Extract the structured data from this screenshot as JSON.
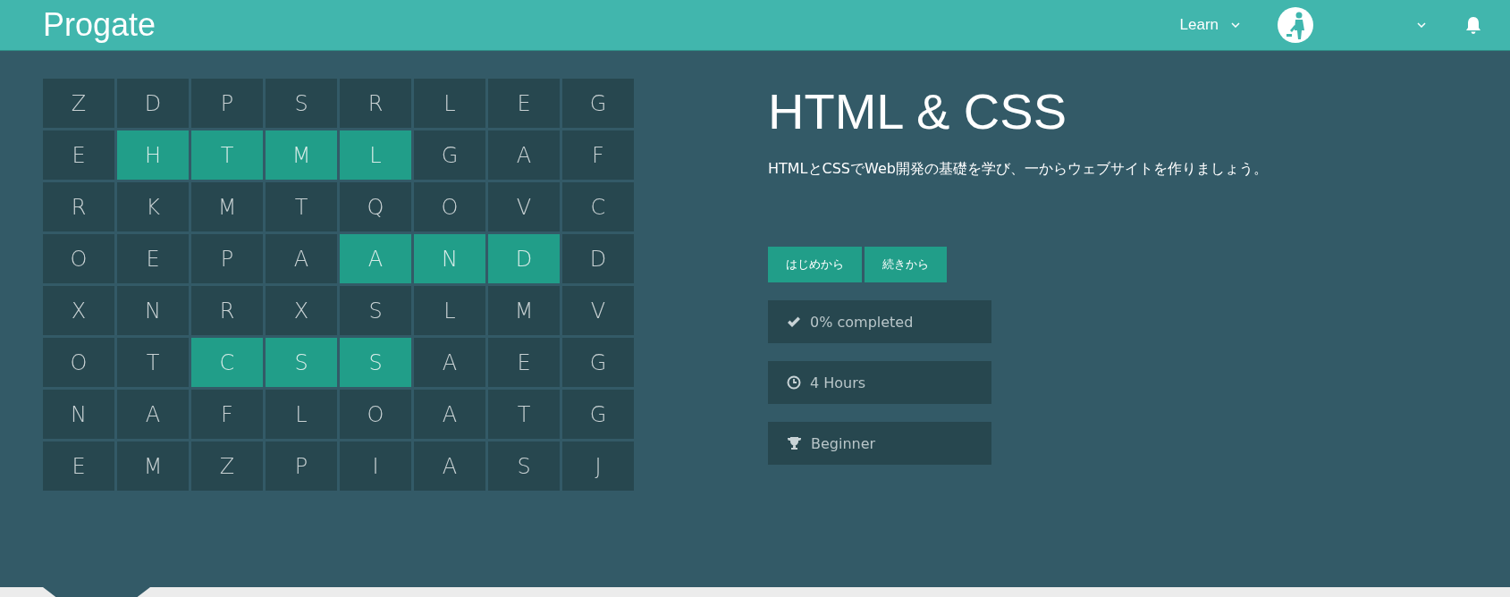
{
  "header": {
    "logo": "Progate",
    "nav": [
      {
        "label": "Learn",
        "kind": "menu"
      }
    ]
  },
  "grid": {
    "rows": [
      [
        {
          "letter": "Z",
          "highlighted": false
        },
        {
          "letter": "D",
          "highlighted": false
        },
        {
          "letter": "P",
          "highlighted": false
        },
        {
          "letter": "S",
          "highlighted": false
        },
        {
          "letter": "R",
          "highlighted": false
        },
        {
          "letter": "L",
          "highlighted": false
        },
        {
          "letter": "E",
          "highlighted": false
        },
        {
          "letter": "G",
          "highlighted": false
        }
      ],
      [
        {
          "letter": "E",
          "highlighted": false
        },
        {
          "letter": "H",
          "highlighted": true
        },
        {
          "letter": "T",
          "highlighted": true
        },
        {
          "letter": "M",
          "highlighted": true
        },
        {
          "letter": "L",
          "highlighted": true
        },
        {
          "letter": "G",
          "highlighted": false
        },
        {
          "letter": "A",
          "highlighted": false
        },
        {
          "letter": "F",
          "highlighted": false
        }
      ],
      [
        {
          "letter": "R",
          "highlighted": false
        },
        {
          "letter": "K",
          "highlighted": false
        },
        {
          "letter": "M",
          "highlighted": false
        },
        {
          "letter": "T",
          "highlighted": false
        },
        {
          "letter": "Q",
          "highlighted": false
        },
        {
          "letter": "O",
          "highlighted": false
        },
        {
          "letter": "V",
          "highlighted": false
        },
        {
          "letter": "C",
          "highlighted": false
        }
      ],
      [
        {
          "letter": "O",
          "highlighted": false
        },
        {
          "letter": "E",
          "highlighted": false
        },
        {
          "letter": "P",
          "highlighted": false
        },
        {
          "letter": "A",
          "highlighted": false
        },
        {
          "letter": "A",
          "highlighted": true
        },
        {
          "letter": "N",
          "highlighted": true
        },
        {
          "letter": "D",
          "highlighted": true
        },
        {
          "letter": "D",
          "highlighted": false
        }
      ],
      [
        {
          "letter": "X",
          "highlighted": false
        },
        {
          "letter": "N",
          "highlighted": false
        },
        {
          "letter": "R",
          "highlighted": false
        },
        {
          "letter": "X",
          "highlighted": false
        },
        {
          "letter": "S",
          "highlighted": false
        },
        {
          "letter": "L",
          "highlighted": false
        },
        {
          "letter": "M",
          "highlighted": false
        },
        {
          "letter": "V",
          "highlighted": false
        }
      ],
      [
        {
          "letter": "O",
          "highlighted": false
        },
        {
          "letter": "T",
          "highlighted": false
        },
        {
          "letter": "C",
          "highlighted": true
        },
        {
          "letter": "S",
          "highlighted": true
        },
        {
          "letter": "S",
          "highlighted": true
        },
        {
          "letter": "A",
          "highlighted": false
        },
        {
          "letter": "E",
          "highlighted": false
        },
        {
          "letter": "G",
          "highlighted": false
        }
      ],
      [
        {
          "letter": "N",
          "highlighted": false
        },
        {
          "letter": "A",
          "highlighted": false
        },
        {
          "letter": "F",
          "highlighted": false
        },
        {
          "letter": "L",
          "highlighted": false
        },
        {
          "letter": "O",
          "highlighted": false
        },
        {
          "letter": "A",
          "highlighted": false
        },
        {
          "letter": "T",
          "highlighted": false
        },
        {
          "letter": "G",
          "highlighted": false
        }
      ],
      [
        {
          "letter": "E",
          "highlighted": false
        },
        {
          "letter": "M",
          "highlighted": false
        },
        {
          "letter": "Z",
          "highlighted": false
        },
        {
          "letter": "P",
          "highlighted": false
        },
        {
          "letter": "I",
          "highlighted": false
        },
        {
          "letter": "A",
          "highlighted": false
        },
        {
          "letter": "S",
          "highlighted": false
        },
        {
          "letter": "J",
          "highlighted": false
        }
      ]
    ]
  },
  "course": {
    "title": "HTML & CSS",
    "description": "HTMLとCSSでWeb開発の基礎を学び、一からウェブサイトを作りましょう。",
    "buttons": [
      "はじめから",
      "続きから"
    ],
    "stats": [
      {
        "kind": "progress",
        "text": "0% completed"
      },
      {
        "kind": "time",
        "text": "4 Hours"
      },
      {
        "kind": "level",
        "text": "Beginner"
      }
    ]
  }
}
